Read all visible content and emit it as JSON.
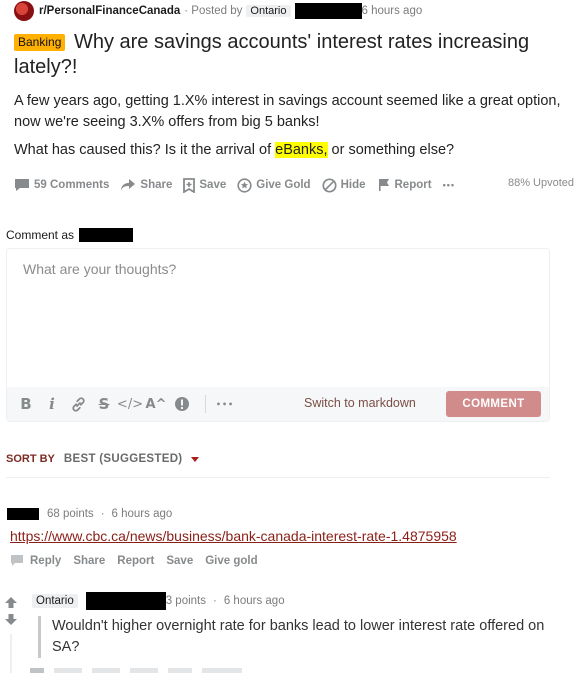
{
  "post": {
    "subreddit": "r/PersonalFinanceCanada",
    "posted_by_prefix": "· Posted by",
    "user_flair": "Ontario",
    "time": "6 hours ago",
    "flair": "Banking",
    "title": "Why are savings accounts' interest rates increasing lately?!",
    "body_p1": "A few years ago, getting 1.X% interest in savings account seemed like a great option, now we're seeing 3.X% offers from big 5 banks!",
    "body_p2_before": "What has caused this? Is it the arrival of ",
    "body_p2_highlight": "eBanks,",
    "body_p2_after": " or something else?",
    "upvoted": "88% Upvoted"
  },
  "post_actions": {
    "comments": "59 Comments",
    "share": "Share",
    "save": "Save",
    "give_gold": "Give Gold",
    "hide": "Hide",
    "report": "Report",
    "more": "•••"
  },
  "comment_box": {
    "comment_as": "Comment as",
    "placeholder": "What are your thoughts?",
    "switch_markdown": "Switch to markdown",
    "submit": "COMMENT",
    "toolbar": {
      "bold": "B",
      "italic": "i",
      "strike": "S",
      "code": "</>",
      "superscript": "A^",
      "more": "•••"
    }
  },
  "sort": {
    "label": "SORT BY",
    "value": "BEST (SUGGESTED)"
  },
  "comments": [
    {
      "points": "68 points",
      "time": "6 hours ago",
      "link": "https://www.cbc.ca/news/business/bank-canada-interest-rate-1.4875958",
      "actions": [
        "Reply",
        "Share",
        "Report",
        "Save",
        "Give gold"
      ]
    },
    {
      "flair": "Ontario",
      "points": "3 points",
      "time": "6 hours ago",
      "text": "Wouldn't higher overnight rate for banks lead to lower interest rate offered on SA?"
    }
  ],
  "colors": {
    "flair_banking": "#ffb000",
    "highlight": "#ffff00",
    "link": "#8a1f18",
    "comment_button": "#d18b8b",
    "sort_label": "#7c2b22"
  }
}
